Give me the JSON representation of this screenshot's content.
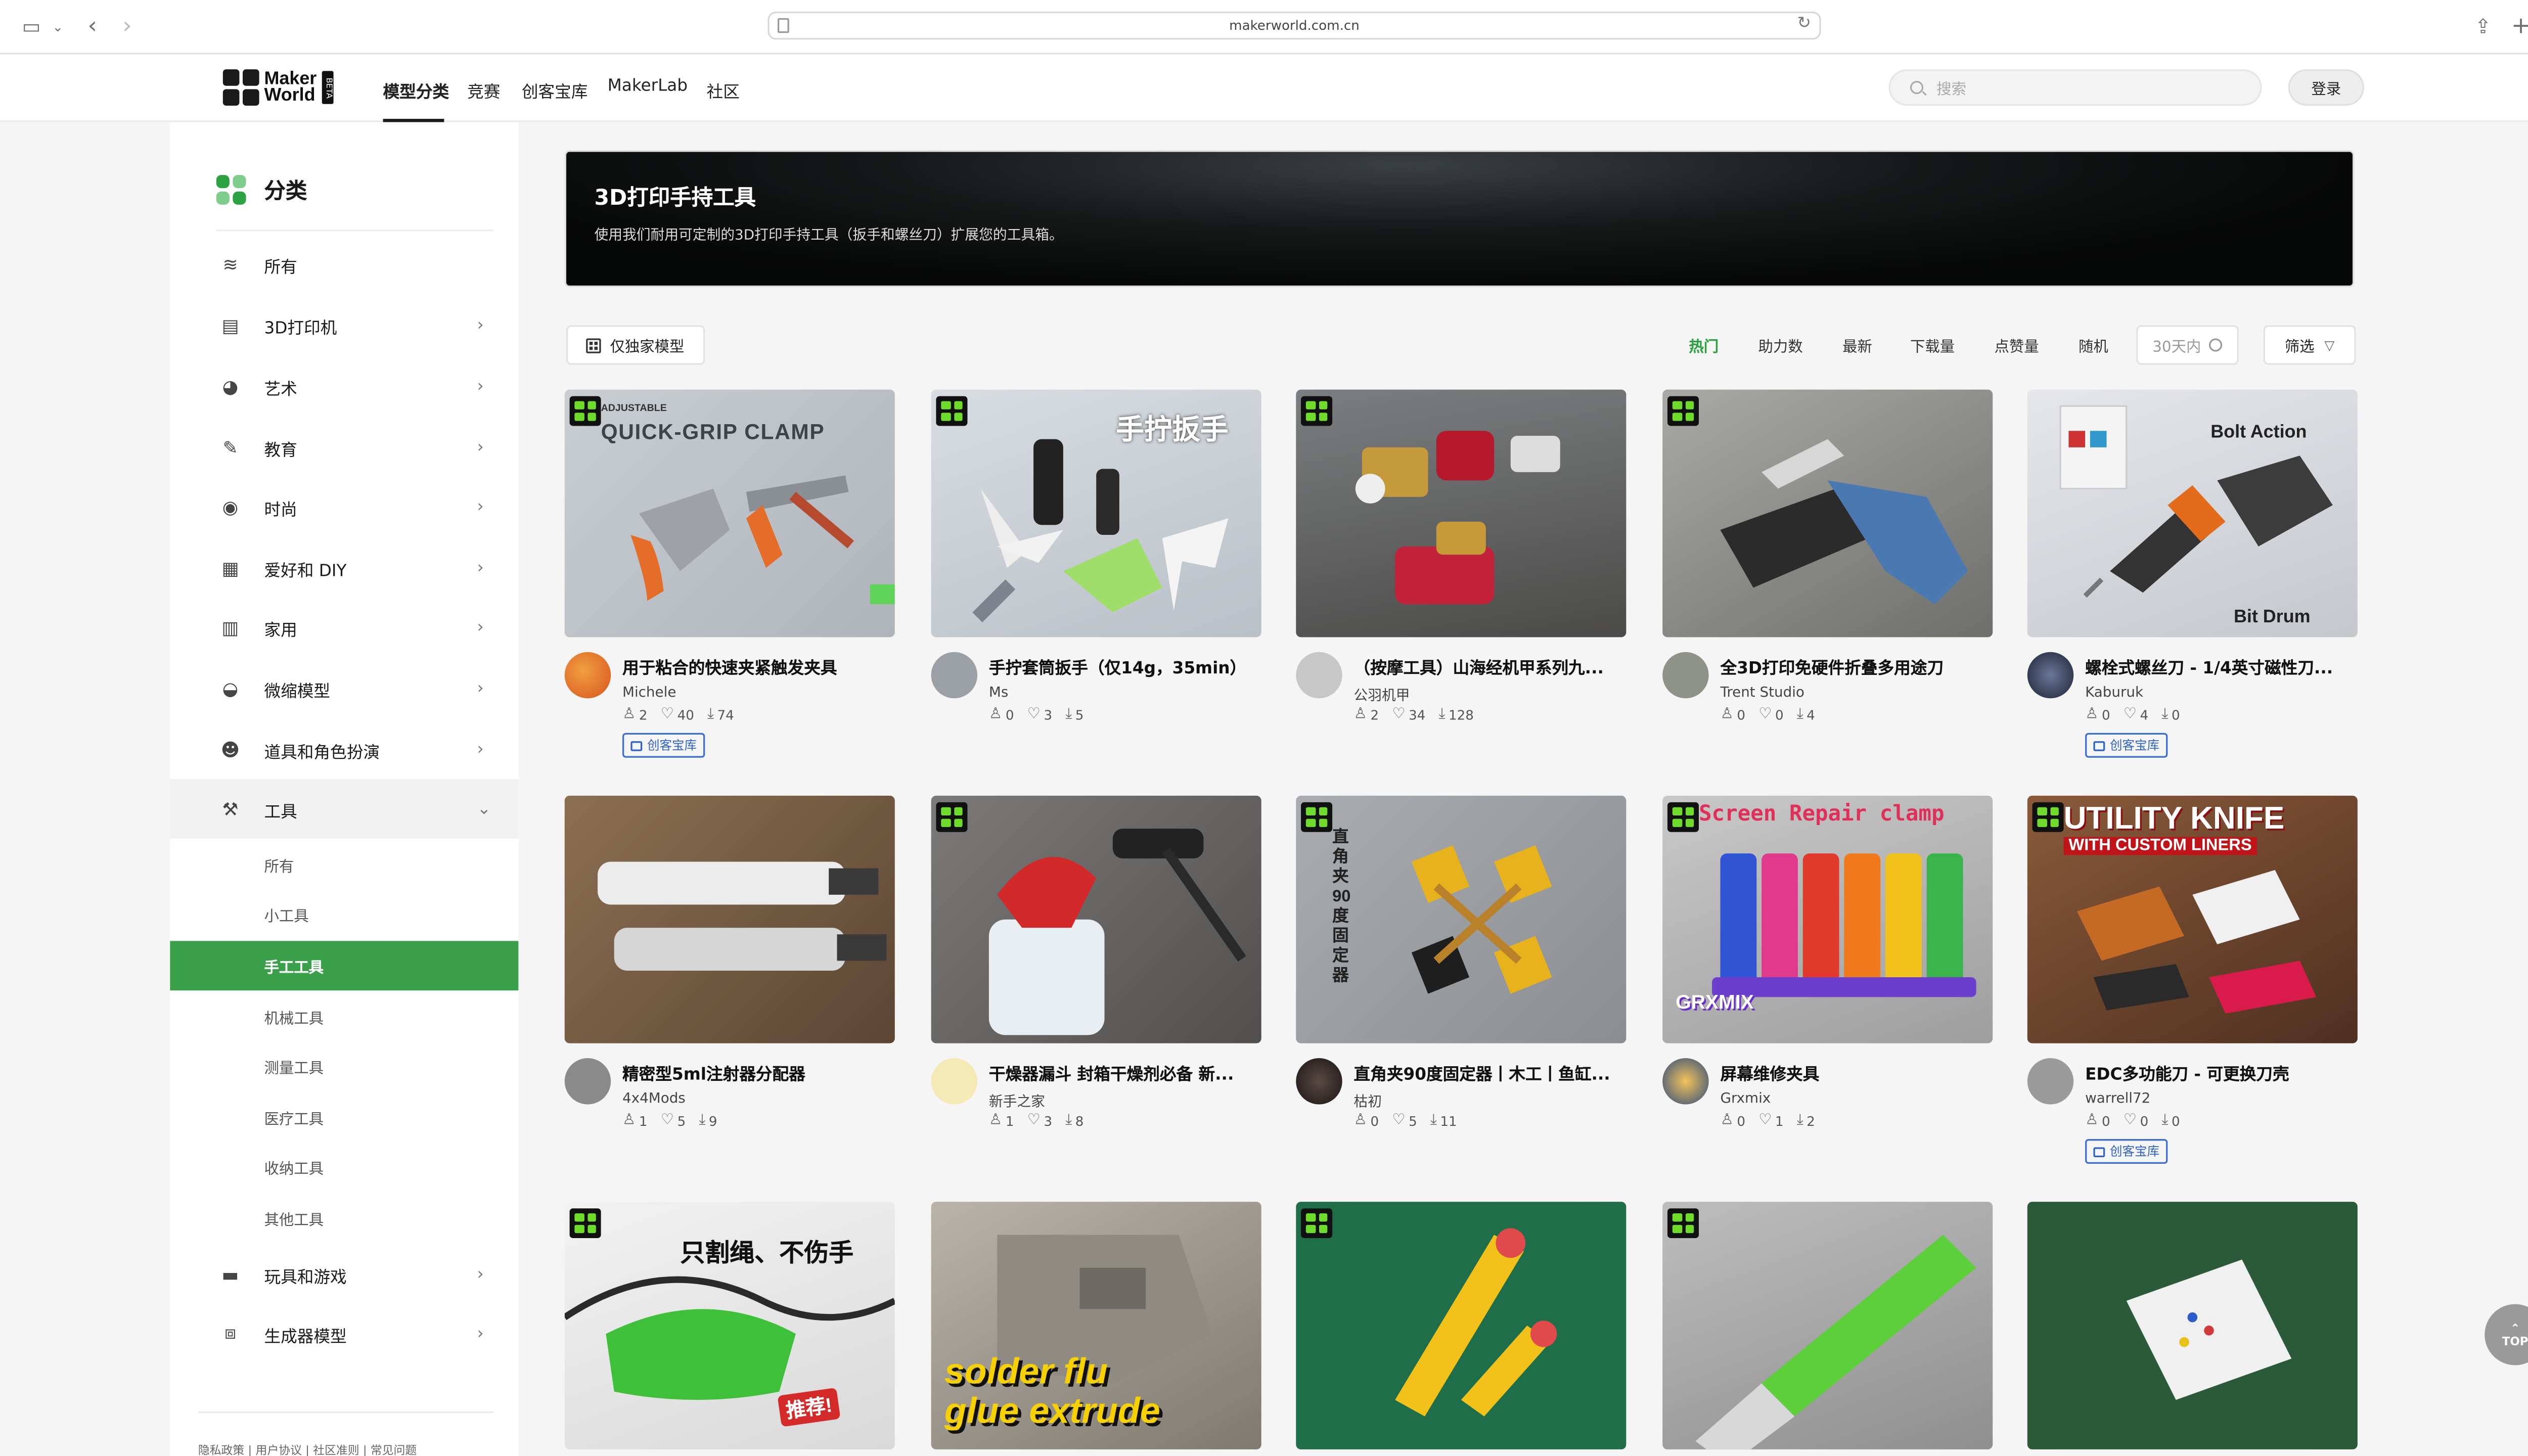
{
  "browser": {
    "url": "makerworld.com.cn"
  },
  "header": {
    "logo_line1": "Maker",
    "logo_line2": "World",
    "logo_beta": "BETA",
    "nav": [
      "模型分类",
      "竞赛",
      "创客宝库",
      "MakerLab",
      "社区"
    ],
    "search_placeholder": "搜索",
    "login_label": "登录"
  },
  "sidebar": {
    "title": "分类",
    "items": [
      {
        "label": "所有",
        "icon": "layers-icon"
      },
      {
        "label": "3D打印机",
        "icon": "printer-icon"
      },
      {
        "label": "艺术",
        "icon": "palette-icon"
      },
      {
        "label": "教育",
        "icon": "pencil-ruler-icon"
      },
      {
        "label": "时尚",
        "icon": "watch-icon"
      },
      {
        "label": "爱好和 DIY",
        "icon": "grid-icon"
      },
      {
        "label": "家用",
        "icon": "fridge-icon"
      },
      {
        "label": "微缩模型",
        "icon": "bowl-icon"
      },
      {
        "label": "道具和角色扮演",
        "icon": "mask-icon"
      },
      {
        "label": "工具",
        "icon": "wrench-icon"
      },
      {
        "label": "玩具和游戏",
        "icon": "gamepad-icon"
      },
      {
        "label": "生成器模型",
        "icon": "generator-icon"
      }
    ],
    "sub_items": [
      "所有",
      "小工具",
      "手工工具",
      "机械工具",
      "测量工具",
      "医疗工具",
      "收纳工具",
      "其他工具"
    ],
    "footer_links": "隐私政策 | 用户协议 | 社区准则 | 常见问题"
  },
  "banner": {
    "title": "3D打印手持工具",
    "description": "使用我们耐用可定制的3D打印手持工具（扳手和螺丝刀）扩展您的工具箱。"
  },
  "filters": {
    "exclusive_label": "仅独家模型",
    "sort_options": [
      "热门",
      "助力数",
      "最新",
      "下载量",
      "点赞量",
      "随机"
    ],
    "period_label": "30天内",
    "filter_label": "筛选"
  },
  "cards": [
    {
      "title": "用于粘合的快速夹紧触发夹具",
      "author": "Michele",
      "boosts": "2",
      "likes": "40",
      "downloads": "74",
      "tag": "创客宝库",
      "overlay": "QUICK-GRIP CLAMP",
      "overlay_small": "ADJUSTABLE"
    },
    {
      "title": "手拧套筒扳手（仅14g，35min）",
      "author": "Ms",
      "boosts": "0",
      "likes": "3",
      "downloads": "5",
      "tag": "",
      "overlay": "手拧扳手",
      "overlay_small": ""
    },
    {
      "title": "（按摩工具）山海经机甲系列九...",
      "author": "公羽机甲",
      "boosts": "2",
      "likes": "34",
      "downloads": "128",
      "tag": "",
      "overlay": "",
      "overlay_small": ""
    },
    {
      "title": "全3D打印免硬件折叠多用途刀",
      "author": "Trent Studio",
      "boosts": "0",
      "likes": "0",
      "downloads": "4",
      "tag": "",
      "overlay": "",
      "overlay_small": ""
    },
    {
      "title": "螺栓式螺丝刀 - 1/4英寸磁性刀...",
      "author": "Kaburuk",
      "boosts": "0",
      "likes": "4",
      "downloads": "0",
      "tag": "创客宝库",
      "overlay": "Bolt Action",
      "overlay_small": "Bit Drum"
    },
    {
      "title": "精密型5ml注射器分配器",
      "author": "4x4Mods",
      "boosts": "1",
      "likes": "5",
      "downloads": "9",
      "tag": "",
      "overlay": "",
      "overlay_small": ""
    },
    {
      "title": "干燥器漏斗 封箱干燥剂必备 新...",
      "author": "新手之家",
      "boosts": "1",
      "likes": "3",
      "downloads": "8",
      "tag": "",
      "overlay": "",
      "overlay_small": ""
    },
    {
      "title": "直角夹90度固定器丨木工丨鱼缸...",
      "author": "枯初",
      "boosts": "0",
      "likes": "5",
      "downloads": "11",
      "tag": "",
      "overlay": "直角夹90度固定器",
      "overlay_small": ""
    },
    {
      "title": "屏幕维修夹具",
      "author": "Grxmix",
      "boosts": "0",
      "likes": "1",
      "downloads": "2",
      "tag": "",
      "overlay": "Screen Repair clamp",
      "overlay_small": "GRXMIX"
    },
    {
      "title": "EDC多功能刀 - 可更换刀壳",
      "author": "warrell72",
      "boosts": "0",
      "likes": "0",
      "downloads": "0",
      "tag": "创客宝库",
      "overlay": "UTILITY KNIFE",
      "overlay_small": "WITH CUSTOM LINERS"
    },
    {
      "title": "",
      "author": "",
      "overlay": "只割绳、不伤手",
      "overlay_small": "推荐!"
    },
    {
      "title": "",
      "author": "",
      "overlay": "solder flu",
      "overlay_small": "glue extrude"
    },
    {
      "title": "",
      "author": "",
      "overlay": "",
      "overlay_small": ""
    },
    {
      "title": "",
      "author": "",
      "overlay": "",
      "overlay_small": ""
    },
    {
      "title": "",
      "author": "",
      "overlay": "",
      "overlay_small": ""
    }
  ],
  "back_to_top": "TOP",
  "colors": {
    "accent": "#3aa14a",
    "tag_blue": "#2f63c7",
    "badge_green": "#6fdc2c"
  }
}
